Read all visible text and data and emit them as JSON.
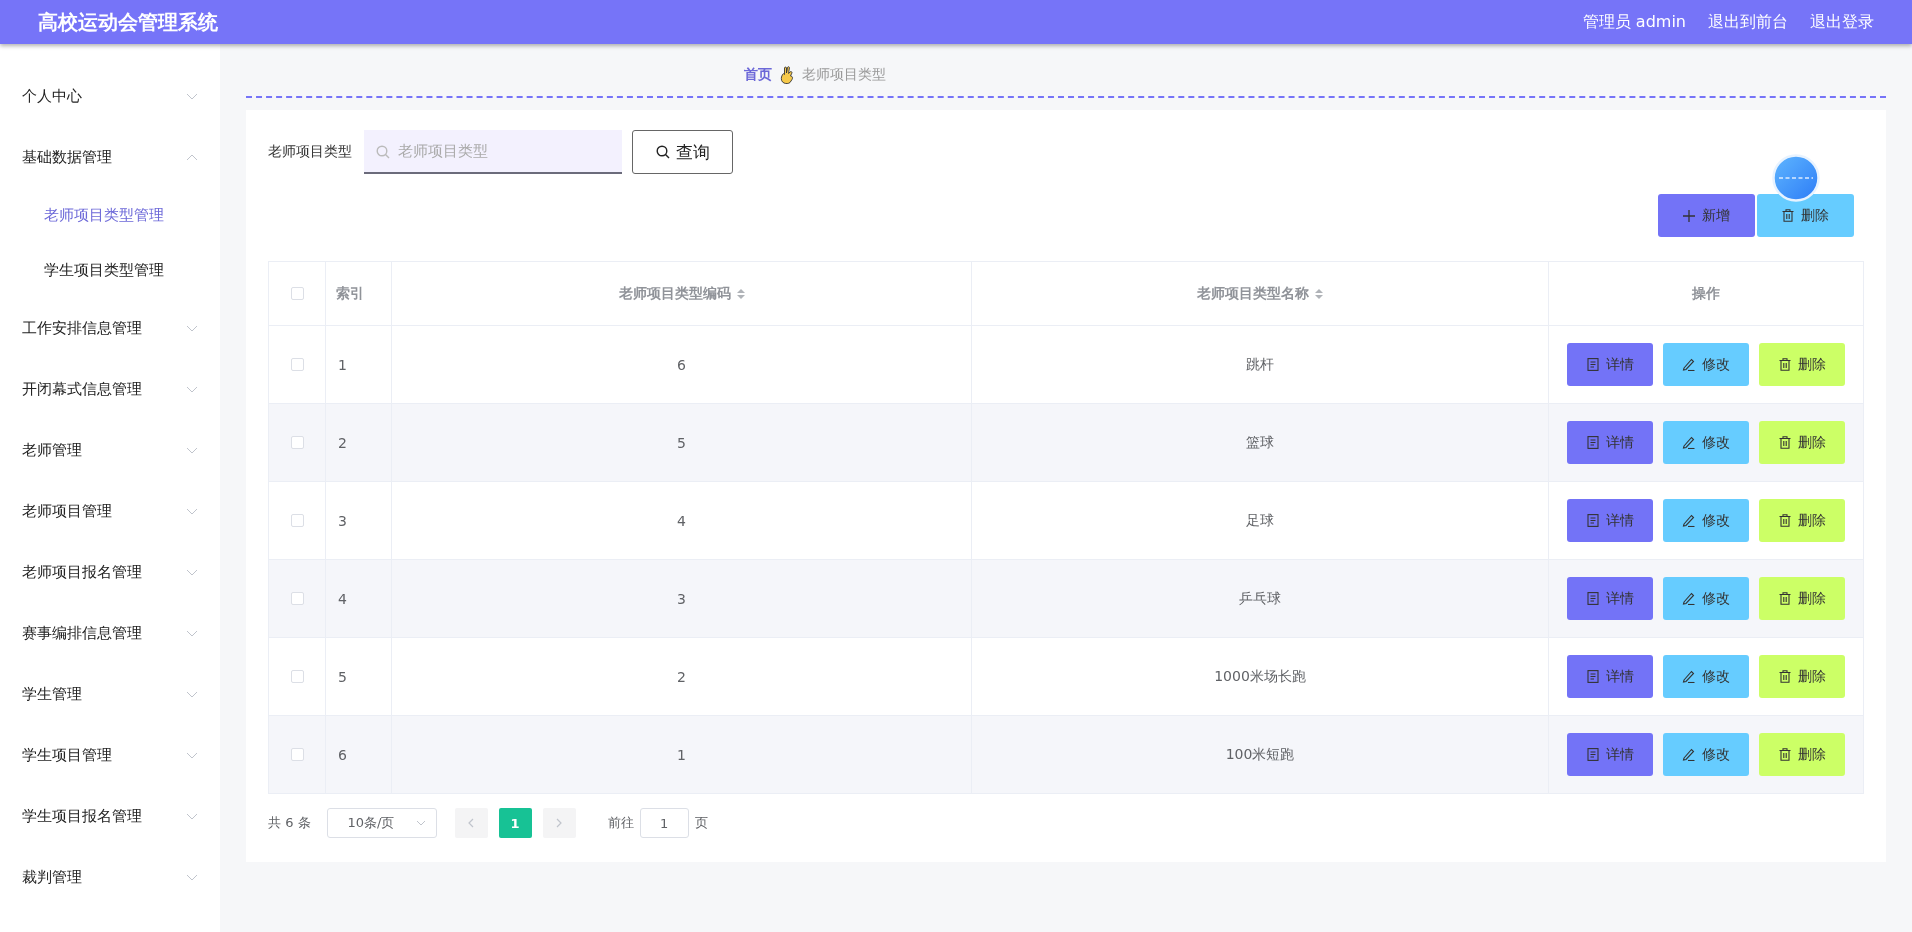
{
  "header": {
    "title": "高校运动会管理系统",
    "user": "管理员 admin",
    "links": [
      "退出到前台",
      "退出登录"
    ]
  },
  "sidebar": {
    "items": [
      {
        "label": "个人中心",
        "expanded": false
      },
      {
        "label": "基础数据管理",
        "expanded": true,
        "children": [
          {
            "label": "老师项目类型管理",
            "selected": true
          },
          {
            "label": "学生项目类型管理",
            "selected": false
          }
        ]
      },
      {
        "label": "工作安排信息管理",
        "expanded": false
      },
      {
        "label": "开闭幕式信息管理",
        "expanded": false
      },
      {
        "label": "老师管理",
        "expanded": false
      },
      {
        "label": "老师项目管理",
        "expanded": false
      },
      {
        "label": "老师项目报名管理",
        "expanded": false
      },
      {
        "label": "赛事编排信息管理",
        "expanded": false
      },
      {
        "label": "学生管理",
        "expanded": false
      },
      {
        "label": "学生项目管理",
        "expanded": false
      },
      {
        "label": "学生项目报名管理",
        "expanded": false
      },
      {
        "label": "裁判管理",
        "expanded": false
      }
    ]
  },
  "breadcrumb": [
    "首页",
    "老师项目类型"
  ],
  "search": {
    "label": "老师项目类型",
    "placeholder": "老师项目类型",
    "button": "查询"
  },
  "actions": [
    {
      "kind": "add",
      "label": "新增"
    },
    {
      "kind": "delete",
      "label": "删除"
    }
  ],
  "table": {
    "all_checked": false,
    "columns": [
      {
        "label": "索引",
        "sortable": false
      },
      {
        "label": "老师项目类型编码",
        "sortable": true
      },
      {
        "label": "老师项目类型名称",
        "sortable": true
      },
      {
        "label": "操作",
        "sortable": false
      }
    ],
    "rows": [
      {
        "checked": false,
        "index": "1",
        "code": "6",
        "name": "跳杆",
        "actions": [
          {
            "kind": "detail",
            "label": "详情"
          },
          {
            "kind": "edit",
            "label": "修改"
          },
          {
            "kind": "delete",
            "label": "删除"
          }
        ]
      },
      {
        "checked": false,
        "index": "2",
        "code": "5",
        "name": "篮球",
        "actions": [
          {
            "kind": "detail",
            "label": "详情"
          },
          {
            "kind": "edit",
            "label": "修改"
          },
          {
            "kind": "delete",
            "label": "删除"
          }
        ]
      },
      {
        "checked": false,
        "index": "3",
        "code": "4",
        "name": "足球",
        "actions": [
          {
            "kind": "detail",
            "label": "详情"
          },
          {
            "kind": "edit",
            "label": "修改"
          },
          {
            "kind": "delete",
            "label": "删除"
          }
        ]
      },
      {
        "checked": false,
        "index": "4",
        "code": "3",
        "name": "乒乓球",
        "actions": [
          {
            "kind": "detail",
            "label": "详情"
          },
          {
            "kind": "edit",
            "label": "修改"
          },
          {
            "kind": "delete",
            "label": "删除"
          }
        ]
      },
      {
        "checked": false,
        "index": "5",
        "code": "2",
        "name": "1000米场长跑",
        "actions": [
          {
            "kind": "detail",
            "label": "详情"
          },
          {
            "kind": "edit",
            "label": "修改"
          },
          {
            "kind": "delete",
            "label": "删除"
          }
        ]
      },
      {
        "checked": false,
        "index": "6",
        "code": "1",
        "name": "100米短跑",
        "actions": [
          {
            "kind": "detail",
            "label": "详情"
          },
          {
            "kind": "edit",
            "label": "修改"
          },
          {
            "kind": "delete",
            "label": "删除"
          }
        ]
      }
    ]
  },
  "pagination": {
    "total": "共 6 条",
    "page_size": "10条/页",
    "pages": [
      {
        "label": "1",
        "selected": true
      }
    ],
    "goto_label": "前往",
    "goto_value": "1",
    "goto_suffix": "页"
  }
}
